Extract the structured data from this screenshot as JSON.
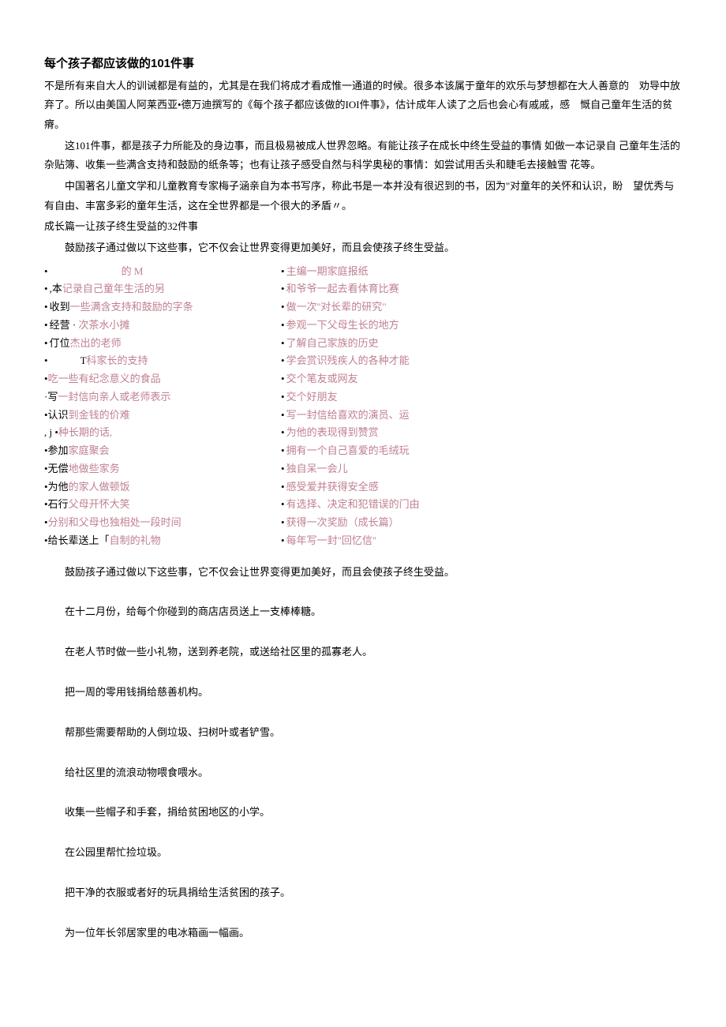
{
  "title": "每个孩子都应该做的101件事",
  "intro": [
    "不是所有来自大人的训诫都是有益的，尤其是在我们将成才看成惟一通道的时候。很多本该属于童年的欢乐与梦想都在大人善意的　劝导中放弃了。所以由美国人阿莱西亚•德万迪撰写的《每个孩子都应该做的IOI件事》，估计成年人读了之后也会心有戚戚，感　慨自己童年生活的贫瘠。",
    "这101件事，都是孩子力所能及的身边事，而且极易被成人世界忽略。有能让孩子在成长中终生受益的事情 如做一本记录自 己童年生活的杂贴簿、收集一些满含支持和鼓励的纸条等；也有让孩子感受自然与科学奥秘的事情：如尝试用舌头和睫毛去接触雪 花等。",
    "中国著名儿童文学和儿童教育专家梅子涵亲自为本书写序，称此书是一本并没有很迟到的书，因为\"对童年的关怀和认识，盼　望优秀与有自由、丰富多彩的童年生活，这在全世界都是一个很大的矛盾〃。"
  ],
  "section1": {
    "heading": "成长篇一让孩子终生受益的32件事",
    "desc": "鼓励孩子通过做以下这些事，它不仅会让世界变得更加美好，而且会使孩子终生受益。"
  },
  "left_items": [
    {
      "b": "•",
      "black": "",
      "pink": "　　　　　　　的 M"
    },
    {
      "b": "•",
      "black": ",本",
      "pink": "记录自己童年生活的另"
    },
    {
      "b": "•",
      "black": " 收到",
      "pink": "一些满含支持和鼓励的字条"
    },
    {
      "b": "•",
      "black": " 经营 · ",
      "pink": "次茶水小摊"
    },
    {
      "b": "•",
      "black": " 仃位",
      "pink": "杰出的老师"
    },
    {
      "b": "•",
      "black": "　　　T",
      "pink": "科家长的支持"
    },
    {
      "b": "",
      "black": "•",
      "pink": "吃一些有纪念意义的食品"
    },
    {
      "b": "",
      "black": "·写",
      "pink": "一封信向亲人或老师表示"
    },
    {
      "b": "",
      "black": "•认识",
      "pink": "到金钱的价难"
    },
    {
      "b": "",
      "black": ", j •",
      "pink": "种长期的话,"
    },
    {
      "b": "",
      "black": "•参加",
      "pink": "家庭聚会"
    },
    {
      "b": "",
      "black": "•无偿",
      "pink": "地做些家务"
    },
    {
      "b": "",
      "black": "•为他",
      "pink": "的家人做顿饭"
    },
    {
      "b": "",
      "black": "•石行",
      "pink": "父母开怀大笑"
    },
    {
      "b": "",
      "black": "•",
      "pink": "分别和父母也独相处一段时间"
    },
    {
      "b": "",
      "black": "•给长辈送上「",
      "pink": "自制的礼物"
    }
  ],
  "right_items": [
    {
      "b": "•",
      "pink": "主编一期家庭报纸"
    },
    {
      "b": "•",
      "pink": "和爷爷一起去看体育比赛"
    },
    {
      "b": "•",
      "pink": "做一次''对长辈的研究\""
    },
    {
      "b": "•",
      "pink": "参观一下父母生长的地方"
    },
    {
      "b": "•",
      "pink": "了解自己家族的历史"
    },
    {
      "b": "•",
      "pink": "学会赏识残疾人的各种才能"
    },
    {
      "b": "•",
      "pink": "交个笔友或网友"
    },
    {
      "b": "•",
      "pink": "交个好朋友"
    },
    {
      "b": "•",
      "pink": "写一封信给喜欢的演员、运"
    },
    {
      "b": "•",
      "pink": "为他的表现得到赞赏"
    },
    {
      "b": "•",
      "pink": "拥有一个自己喜爱的毛绒玩"
    },
    {
      "b": "•",
      "pink": "独自呆一会儿"
    },
    {
      "b": "•",
      "pink": "感受爱并获得安全感"
    },
    {
      "b": "•",
      "pink": "有选择、决定和犯错误的门由"
    },
    {
      "b": "•",
      "pink": "获得一次奖励（成长篇）"
    },
    {
      "b": "•",
      "pink": "每年写一封\"回忆信\""
    }
  ],
  "section2_desc": "鼓励孩子通过做以下这些事，它不仅会让世界变得更加美好，而且会使孩子终生受益。",
  "paragraphs": [
    "在十二月份，给每个你碰到的商店店员送上一支棒棒糖。",
    "在老人节时做一些小礼物，送到养老院，或送给社区里的孤寡老人。",
    "把一周的零用钱捐给慈善机构。",
    "帮那些需要帮助的人倒垃圾、扫树叶或者铲雪。",
    "给社区里的流浪动物喂食喂水。",
    "收集一些帽子和手套，捐给贫困地区的小学。",
    "在公园里帮忙捡垃圾。",
    "把干净的衣服或者好的玩具捐给生活贫困的孩子。",
    "为一位年长邻居家里的电冰箱画一幅画。"
  ]
}
